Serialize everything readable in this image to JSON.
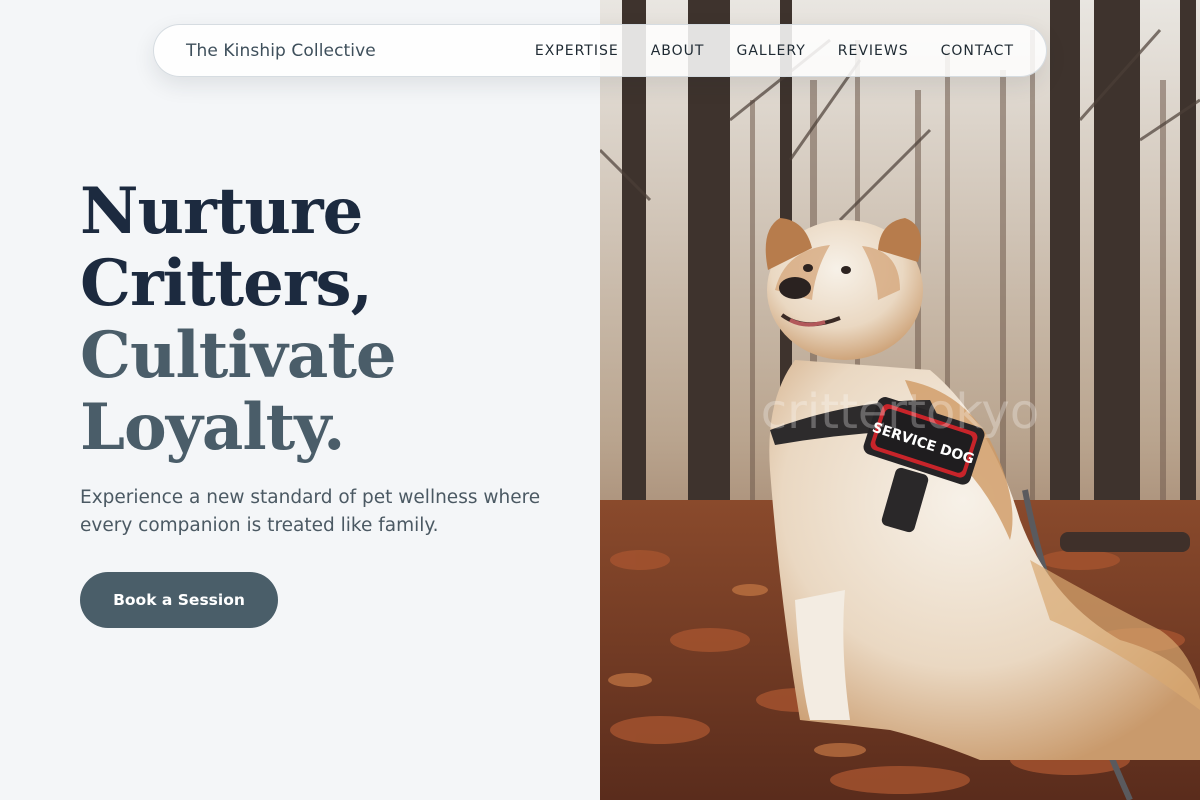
{
  "brand": "The Kinship Collective",
  "nav": {
    "links": [
      "EXPERTISE",
      "ABOUT",
      "GALLERY",
      "REVIEWS",
      "CONTACT"
    ]
  },
  "hero": {
    "headline": {
      "line1": "Nurture",
      "line2": "Critters,",
      "line3": "Cultivate",
      "line4": "Loyalty."
    },
    "subtitle": "Experience a new standard of pet wellness where every companion is treated like family.",
    "cta": "Book a Session",
    "image": {
      "harness_text": "SERVICE DOG",
      "watermark": "crittertokyo"
    }
  },
  "colors": {
    "headline_dark": "#1c2a3f",
    "headline_muted": "#4a5d69",
    "button_bg": "#4a5e69",
    "page_bg": "#f4f6f8"
  }
}
